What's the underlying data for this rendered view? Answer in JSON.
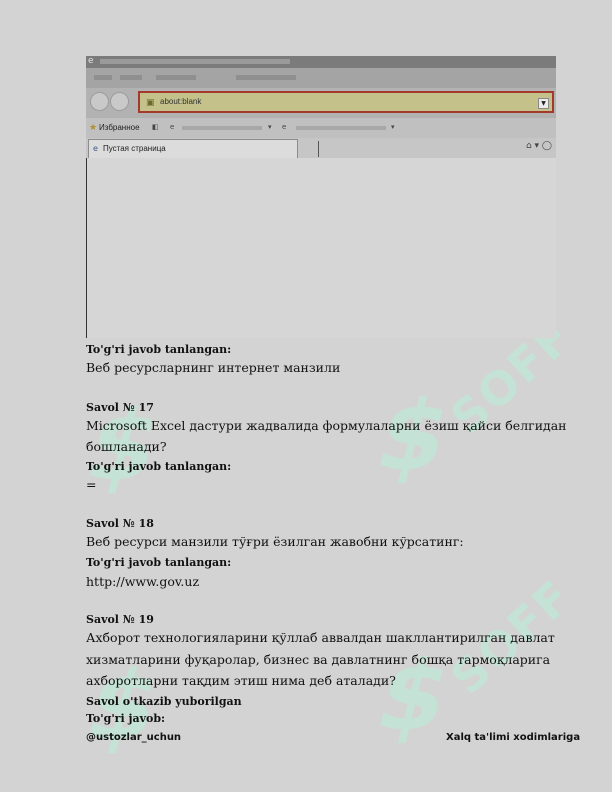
{
  "browser": {
    "address": "about:blank",
    "favorites_label": "Избранное",
    "tab_title": "Пустая страница"
  },
  "content": {
    "q16_answer_label": "To'g'ri javob tanlangan:",
    "q16_answer": "Веб ресурсларнинг интернет манзили",
    "q17_title": "Savol № 17",
    "q17_text_1": "Microsoft Excel дастури жадвалида формулаларни ёзиш қайси белгидан",
    "q17_text_2": "бошланади?",
    "q17_answer_label": "To'g'ri javob tanlangan:",
    "q17_answer": "=",
    "q18_title": "Savol № 18",
    "q18_text": "Веб ресурси манзили тўғри ёзилган жавобни кўрсатинг:",
    "q18_answer_label": "To'g'ri javob tanlangan:",
    "q18_answer": "http://www.gov.uz",
    "q19_title": "Savol № 19",
    "q19_text_1": "Ахборот технологияларини қўллаб аввалдан шакллантирилган давлат",
    "q19_text_2": "хизматларини фуқаролар, бизнес ва давлатнинг бошқа тармоқларига",
    "q19_text_3": "ахборотларни тақдим этиш нима деб аталади?",
    "q19_status": "Savol o'tkazib yuborilgan",
    "q19_answer_label": "To'g'ri javob:"
  },
  "footer": {
    "left": "@ustozlar_uchun",
    "right": "Xalq ta'limi xodimlariga"
  },
  "watermark": {
    "word": "SOFF"
  },
  "colors": {
    "page_bg": "#d3d3d3",
    "watermark": "#bfe8d6",
    "address_border": "#a33a2e"
  }
}
